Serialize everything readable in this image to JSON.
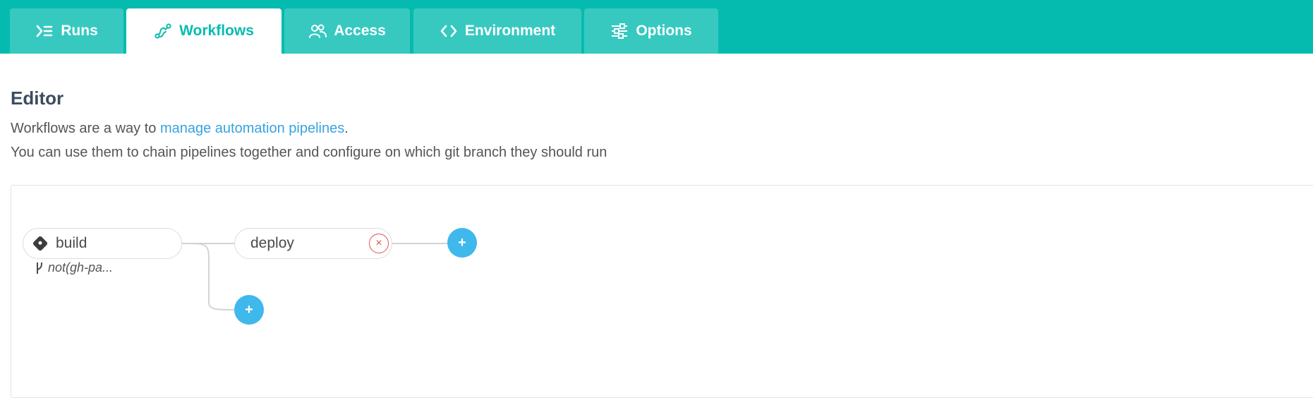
{
  "tabs": [
    {
      "label": "Runs",
      "icon": "runs-icon",
      "active": false
    },
    {
      "label": "Workflows",
      "icon": "workflows-icon",
      "active": true
    },
    {
      "label": "Access",
      "icon": "access-icon",
      "active": false
    },
    {
      "label": "Environment",
      "icon": "code-icon",
      "active": false
    },
    {
      "label": "Options",
      "icon": "sliders-icon",
      "active": false
    }
  ],
  "editor": {
    "title": "Editor",
    "desc_line1_before": "Workflows are a way to ",
    "desc_line1_link": "manage automation pipelines",
    "desc_line1_after": ".",
    "desc_line2": "You can use them to chain pipelines together and configure on which git branch they should run"
  },
  "workflow": {
    "build_label": "build",
    "build_branch": "not(gh-pa...",
    "deploy_label": "deploy",
    "remove_label": "×",
    "add_label": "+"
  },
  "colors": {
    "brand": "#05bbb0",
    "tab_inactive": "#37c9c0",
    "link": "#37a3de",
    "add_button": "#3fb8ec",
    "remove": "#e05151"
  }
}
